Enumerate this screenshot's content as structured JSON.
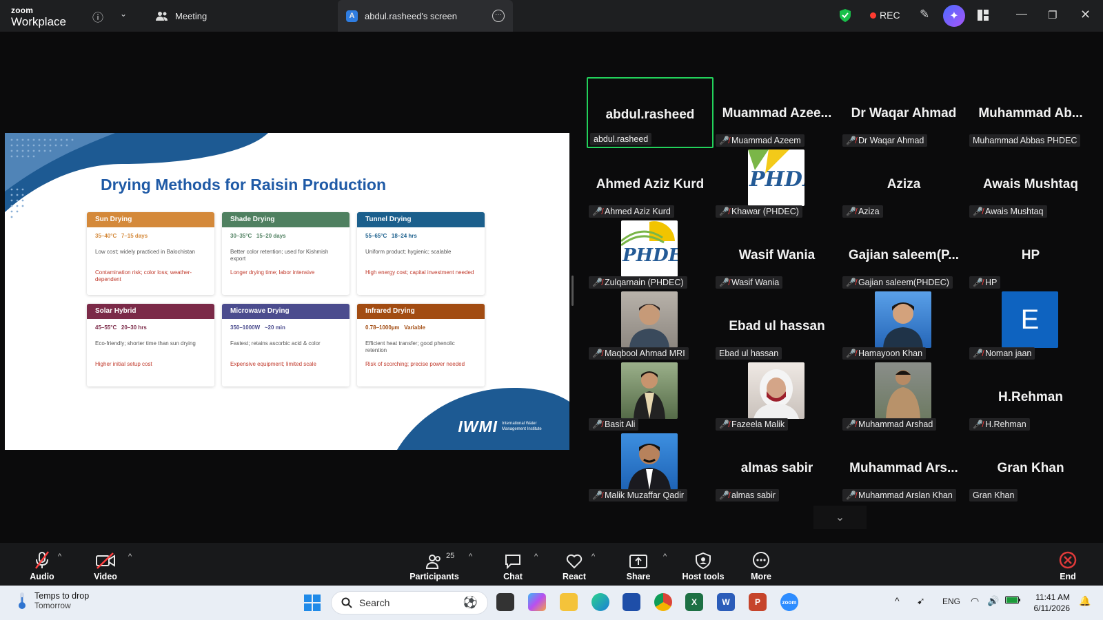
{
  "titlebar": {
    "logo_top": "zoom",
    "logo_bottom": "Workplace",
    "meeting_tab": "Meeting",
    "screen_tab": "abdul.rasheed's screen",
    "screen_tab_avatar": "A",
    "rec_label": "REC",
    "icons": [
      "info-icon",
      "chevron-down-icon",
      "people-icon",
      "more-icon",
      "shield-icon",
      "pencil-icon",
      "ai-companion-icon",
      "layout-icon",
      "minimize-icon",
      "restore-icon",
      "close-icon"
    ]
  },
  "slide": {
    "title": "Drying Methods for Raisin Production",
    "cards": [
      {
        "name": "Sun Drying",
        "color": "#d4893a",
        "temp": "35–40°C",
        "time": "7–15 days",
        "pro": "Low cost; widely practiced in Balochistan",
        "con": "Contamination risk; color loss; weather-dependent"
      },
      {
        "name": "Shade Drying",
        "color": "#4f8060",
        "temp": "30–35°C",
        "time": "15–20 days",
        "pro": "Better color retention; used for Kishmish export",
        "con": "Longer drying time; labor intensive"
      },
      {
        "name": "Tunnel Drying",
        "color": "#1b5f8c",
        "temp": "55–65°C",
        "time": "18–24 hrs",
        "pro": "Uniform product; hygienic; scalable",
        "con": "High energy cost; capital investment needed"
      },
      {
        "name": "Solar Hybrid",
        "color": "#7b2a48",
        "temp": "45–55°C",
        "time": "20–30 hrs",
        "pro": "Eco-friendly; shorter time than sun drying",
        "con": "Higher initial setup cost"
      },
      {
        "name": "Microwave Drying",
        "color": "#4b4c8e",
        "temp": "350–1000W",
        "time": "~20 min",
        "pro": "Fastest; retains ascorbic acid & color",
        "con": "Expensive equipment; limited scale"
      },
      {
        "name": "Infrared Drying",
        "color": "#a24c12",
        "temp": "0.78–1000µm",
        "time": "Variable",
        "pro": "Efficient heat transfer; good phenolic retention",
        "con": "Risk of scorching; precise power needed"
      }
    ],
    "logo_text": "IWMI",
    "logo_sub": "International Water Management Institute"
  },
  "gallery": [
    {
      "big": "abdul.rasheed",
      "label": "abdul.rasheed",
      "muted": false,
      "active": true
    },
    {
      "big": "Muammad  Azee...",
      "label": "Muammad Azeem",
      "muted": true
    },
    {
      "big": "Dr Waqar Ahmad",
      "label": "Dr Waqar Ahmad",
      "muted": true
    },
    {
      "big": "Muhammad  Ab...",
      "label": "Muhammad Abbas PHDEC",
      "muted": false
    },
    {
      "big": "Ahmed Aziz Kurd",
      "label": "Ahmed Aziz Kurd",
      "muted": true
    },
    {
      "photo": "phdec",
      "photo_text": "PHDE",
      "label": "Khawar (PHDEC)",
      "muted": true
    },
    {
      "big": "Aziza",
      "label": "Aziza",
      "muted": true
    },
    {
      "big": "Awais Mushtaq",
      "label": "Awais Mushtaq",
      "muted": true
    },
    {
      "photo": "phdec2",
      "photo_text": "PHDEC",
      "label": "Zulqarnain (PHDEC)",
      "muted": true
    },
    {
      "big": "Wasif Wania",
      "label": "Wasif Wania",
      "muted": true
    },
    {
      "big": "Gajian  saleem(P...",
      "label": "Gajian saleem(PHDEC)",
      "muted": true
    },
    {
      "big": "HP",
      "label": "HP",
      "muted": true
    },
    {
      "photo": "person",
      "label": "Maqbool Ahmad MRI",
      "muted": true
    },
    {
      "big": "Ebad ul hassan",
      "label": "Ebad ul hassan",
      "muted": false
    },
    {
      "photo": "person2",
      "label": "Hamayoon Khan",
      "muted": true
    },
    {
      "photo": "letter",
      "photo_text": "E",
      "label": "Noman jaan",
      "muted": true
    },
    {
      "photo": "person3",
      "label": "Basit Ali",
      "muted": true
    },
    {
      "photo": "person4",
      "label": "Fazeela Malik",
      "muted": true
    },
    {
      "photo": "person5",
      "label": "Muhammad Arshad",
      "muted": true
    },
    {
      "big": "H.Rehman",
      "label": "H.Rehman",
      "muted": true
    },
    {
      "photo": "person6",
      "label": "Malik Muzaffar Qadir",
      "muted": true
    },
    {
      "big": "almas sabir",
      "label": "almas sabir",
      "muted": true
    },
    {
      "big": "Muhammad  Ars...",
      "label": "Muhammad Arslan Khan",
      "muted": true
    },
    {
      "big": "Gran Khan",
      "label": "Gran Khan",
      "muted": false
    }
  ],
  "toolbar": {
    "audio": "Audio",
    "video": "Video",
    "participants": "Participants",
    "participants_count": "25",
    "chat": "Chat",
    "react": "React",
    "share": "Share",
    "host_tools": "Host tools",
    "more": "More",
    "end": "End"
  },
  "taskbar": {
    "weather_line1": "Temps to drop",
    "weather_line2": "Tomorrow",
    "search_placeholder": "Search",
    "language": "ENG",
    "time": "11:41 AM",
    "date": "6/11/2026"
  },
  "colors": {
    "active_speaker": "#22d15b",
    "slide_title": "#1f5aa6",
    "mic_muted": "#ff4040",
    "end_red": "#e03a3a"
  }
}
